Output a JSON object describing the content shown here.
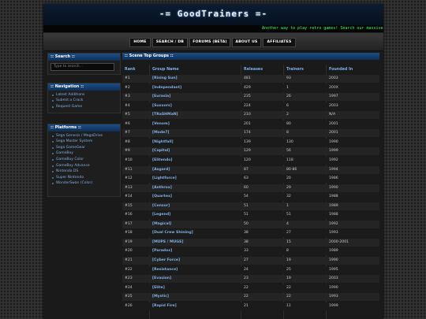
{
  "header": {
    "title": "-= GoodTrainers =-",
    "ticker": "Another way to play retro games! Search our massive"
  },
  "nav": {
    "items": [
      "HOME",
      "SEARCH / DB",
      "FORUMS (BETA)",
      "ABOUT US",
      "AFFILIATES"
    ]
  },
  "sidebar": {
    "search_title": ":: Search ::",
    "search_placeholder": "Type to search...",
    "navigation_title": ":: Navigation ::",
    "navigation_items": [
      "Latest Additions",
      "Submit a Crack",
      "Request Game"
    ],
    "platforms_title": ":: Platforms ::",
    "platform_items": [
      "Sega Genesis / MegaDrive",
      "Sega Master System",
      "Sega GameGear",
      "GameBoy",
      "GameBoy Color",
      "GameBoy Advance",
      "Nintendo DS",
      "Super Nintendo",
      "WonderSwan (Color)"
    ]
  },
  "main": {
    "title": ":: Scene Top Groups ::",
    "columns": [
      "Rank",
      "Group Name",
      "Releases",
      "Trainers",
      "Founded In"
    ],
    "rows": [
      [
        "#1",
        "[Rising Sun]",
        "481",
        "93",
        "2003"
      ],
      [
        "#2",
        "[Independant]",
        "429",
        "1",
        "200X"
      ],
      [
        "#3",
        "[Eurasia]",
        "235",
        "26",
        "1997"
      ],
      [
        "#4",
        "[Suxxors]",
        "224",
        "6",
        "2003"
      ],
      [
        "#5",
        "[TRaSHMaN]",
        "210",
        "2",
        "N/A"
      ],
      [
        "#6",
        "[Venom]",
        "201",
        "80",
        "2001"
      ],
      [
        "#7",
        "[Mode7]",
        "174",
        "8",
        "2001"
      ],
      [
        "#8",
        "[Nightfall]",
        "139",
        "130",
        "1990"
      ],
      [
        "#9",
        "[Capital]",
        "129",
        "56",
        "1999"
      ],
      [
        "#10",
        "[Elitendo]",
        "120",
        "118",
        "1992"
      ],
      [
        "#11",
        "[Asgard]",
        "87",
        "80-86",
        "1994"
      ],
      [
        "#12",
        "[Lightforce]",
        "63",
        "20",
        "1986"
      ],
      [
        "#13",
        "[Anthrox]",
        "60",
        "29",
        "1990"
      ],
      [
        "#14",
        "[Quartex]",
        "54",
        "32",
        "1988"
      ],
      [
        "#15",
        "[Censor]",
        "51",
        "1",
        "1989"
      ],
      [
        "#16",
        "[Legend]",
        "51",
        "51",
        "1988"
      ],
      [
        "#17",
        "[Magical]",
        "50",
        "4",
        "1992"
      ],
      [
        "#18",
        "[Dual Crew Shining]",
        "38",
        "27",
        "1993"
      ],
      [
        "#19",
        "[MUPS / MUGS]",
        "38",
        "15",
        "2000-2001"
      ],
      [
        "#20",
        "[Paradox]",
        "33",
        "8",
        "1989"
      ],
      [
        "#21",
        "[Cyber Force]",
        "27",
        "19",
        "1990"
      ],
      [
        "#22",
        "[Resistance]",
        "24",
        "25",
        "1995"
      ],
      [
        "#23",
        "[Evasion]",
        "23",
        "19",
        "2003"
      ],
      [
        "#24",
        "[Elite]",
        "22",
        "22",
        "1990"
      ],
      [
        "#25",
        "[Mystic]",
        "22",
        "22",
        "1993"
      ],
      [
        "#26",
        "[Rapid Fire]",
        "21",
        "11",
        "1999"
      ]
    ]
  }
}
